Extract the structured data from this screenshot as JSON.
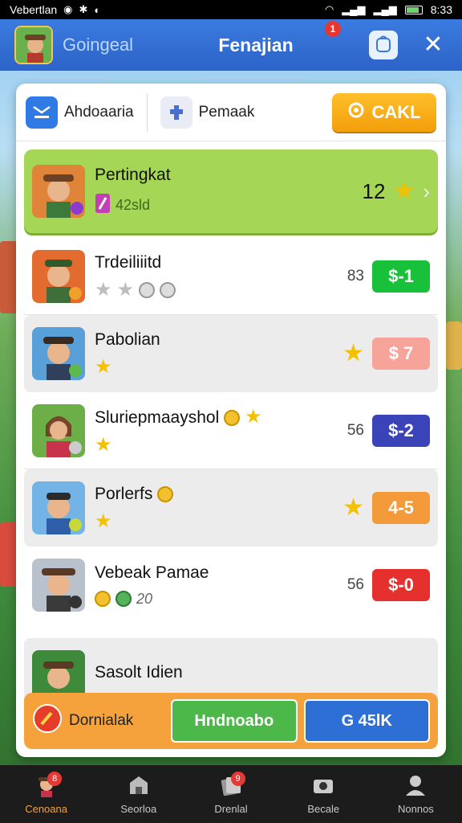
{
  "status_bar": {
    "carrier": "Vebertlan",
    "time": "8:33"
  },
  "header": {
    "left_title": "Goingeal",
    "title": "Fenajian",
    "notification_count": "1"
  },
  "tabs": [
    {
      "label": "Ahdoaaria",
      "icon": "inbox-icon"
    },
    {
      "label": "Pemaak",
      "icon": "puzzle-icon"
    }
  ],
  "cta_label": "CAKL",
  "rows": [
    {
      "name": "Pertingkat",
      "sub": "42sld",
      "rank": "12",
      "price": "",
      "price_color": "",
      "stars": 0,
      "highlight": true
    },
    {
      "name": "Trdeiliiitd",
      "sub": "",
      "rank": "83",
      "price": "$-1",
      "price_color": "#19c13a",
      "stars": 2
    },
    {
      "name": "Pabolian",
      "sub": "",
      "rank": "",
      "price": "$ 7",
      "price_color": "#f6a39a",
      "stars": 1
    },
    {
      "name": "Sluriepmaayshol",
      "sub": "",
      "rank": "56",
      "price": "$-2",
      "price_color": "#3a44b8",
      "stars": 1
    },
    {
      "name": "Porlerfs",
      "sub": "",
      "rank": "",
      "price": "4-5",
      "price_color": "#f39a3a",
      "stars": 1
    },
    {
      "name": "Vebeak Pamae",
      "sub": "20",
      "rank": "56",
      "price": "$-0",
      "price_color": "#e5302e",
      "stars": 0
    },
    {
      "name": "Sasolt Idien",
      "sub": "",
      "rank": "",
      "price": "",
      "price_color": "",
      "stars": 0
    }
  ],
  "bottom_bar": {
    "label": "Dornialak",
    "green_button": "Hndnoabo",
    "blue_button": "G 45lK"
  },
  "nav": [
    {
      "label": "Cenoana",
      "icon": "character-icon",
      "badge": "8"
    },
    {
      "label": "Seorloa",
      "icon": "shop-icon",
      "badge": ""
    },
    {
      "label": "Drenlal",
      "icon": "cards-icon",
      "badge": "9"
    },
    {
      "label": "Becale",
      "icon": "camera-icon",
      "badge": ""
    },
    {
      "label": "Nonnos",
      "icon": "profile-icon",
      "badge": ""
    }
  ]
}
